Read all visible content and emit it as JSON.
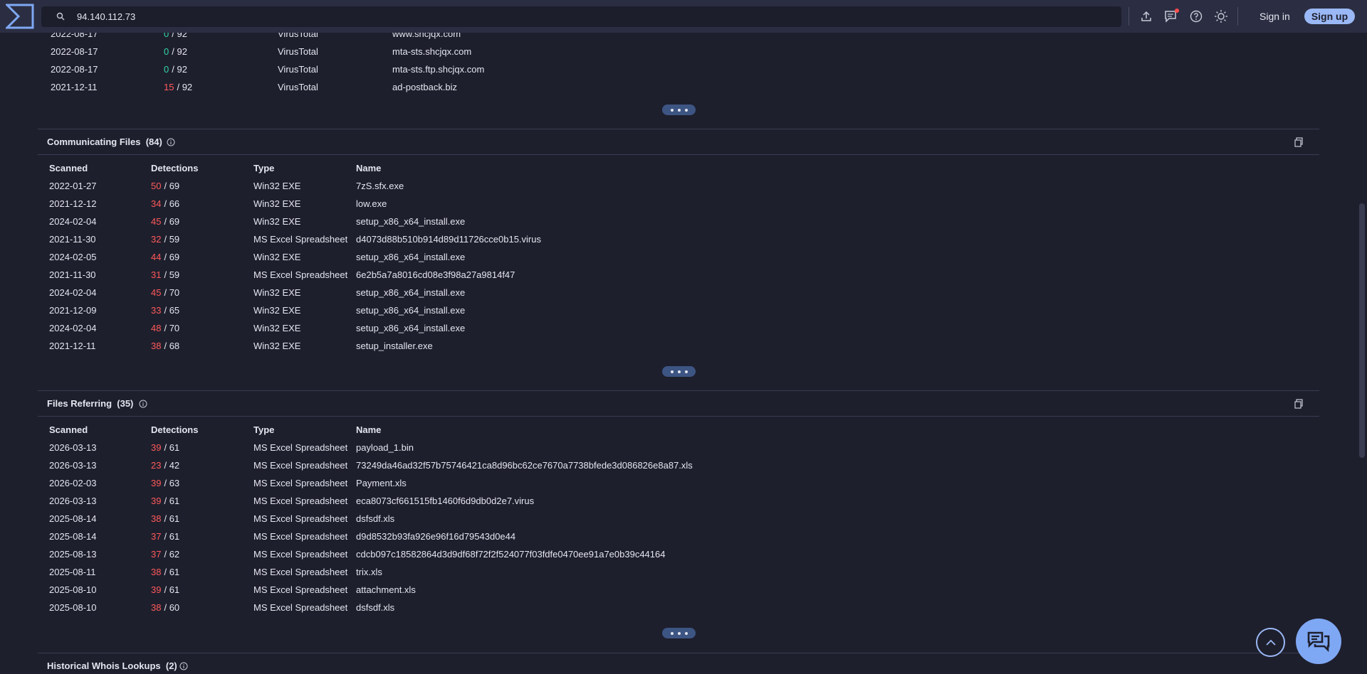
{
  "search": {
    "value": "94.140.112.73"
  },
  "header": {
    "signin_label": "Sign in",
    "signup_label": "Sign up"
  },
  "partial_rows": [
    {
      "date": "2022-08-17",
      "detected": "0",
      "total": "/ 92",
      "detected_color": "green",
      "source": "VirusTotal",
      "name": "www.shcjqx.com"
    },
    {
      "date": "2022-08-17",
      "detected": "0",
      "total": "/ 92",
      "detected_color": "green",
      "source": "VirusTotal",
      "name": "mta-sts.shcjqx.com"
    },
    {
      "date": "2022-08-17",
      "detected": "0",
      "total": "/ 92",
      "detected_color": "green",
      "source": "VirusTotal",
      "name": "mta-sts.ftp.shcjqx.com"
    },
    {
      "date": "2021-12-11",
      "detected": "15",
      "total": "/ 92",
      "detected_color": "red",
      "source": "VirusTotal",
      "name": "ad-postback.biz"
    }
  ],
  "communicating_files": {
    "title": "Communicating Files",
    "count": "(84)",
    "columns": [
      "Scanned",
      "Detections",
      "Type",
      "Name"
    ],
    "rows": [
      {
        "date": "2022-01-27",
        "detected": "50",
        "total": "/ 69",
        "type": "Win32 EXE",
        "name": "7zS.sfx.exe"
      },
      {
        "date": "2021-12-12",
        "detected": "34",
        "total": "/ 66",
        "type": "Win32 EXE",
        "name": "low.exe"
      },
      {
        "date": "2024-02-04",
        "detected": "45",
        "total": "/ 69",
        "type": "Win32 EXE",
        "name": "setup_x86_x64_install.exe"
      },
      {
        "date": "2021-11-30",
        "detected": "32",
        "total": "/ 59",
        "type": "MS Excel Spreadsheet",
        "name": "d4073d88b510b914d89d11726cce0b15.virus"
      },
      {
        "date": "2024-02-05",
        "detected": "44",
        "total": "/ 69",
        "type": "Win32 EXE",
        "name": "setup_x86_x64_install.exe"
      },
      {
        "date": "2021-11-30",
        "detected": "31",
        "total": "/ 59",
        "type": "MS Excel Spreadsheet",
        "name": "6e2b5a7a8016cd08e3f98a27a9814f47"
      },
      {
        "date": "2024-02-04",
        "detected": "45",
        "total": "/ 70",
        "type": "Win32 EXE",
        "name": "setup_x86_x64_install.exe"
      },
      {
        "date": "2021-12-09",
        "detected": "33",
        "total": "/ 65",
        "type": "Win32 EXE",
        "name": "setup_x86_x64_install.exe"
      },
      {
        "date": "2024-02-04",
        "detected": "48",
        "total": "/ 70",
        "type": "Win32 EXE",
        "name": "setup_x86_x64_install.exe"
      },
      {
        "date": "2021-12-11",
        "detected": "38",
        "total": "/ 68",
        "type": "Win32 EXE",
        "name": "setup_installer.exe"
      }
    ]
  },
  "files_referring": {
    "title": "Files Referring",
    "count": "(35)",
    "columns": [
      "Scanned",
      "Detections",
      "Type",
      "Name"
    ],
    "rows": [
      {
        "date": "2026-03-13",
        "detected": "39",
        "total": "/ 61",
        "type": "MS Excel Spreadsheet",
        "name": "payload_1.bin"
      },
      {
        "date": "2026-03-13",
        "detected": "23",
        "total": "/ 42",
        "type": "MS Excel Spreadsheet",
        "name": "73249da46ad32f57b75746421ca8d96bc62ce7670a7738bfede3d086826e8a87.xls"
      },
      {
        "date": "2026-02-03",
        "detected": "39",
        "total": "/ 63",
        "type": "MS Excel Spreadsheet",
        "name": "Payment.xls"
      },
      {
        "date": "2026-03-13",
        "detected": "39",
        "total": "/ 61",
        "type": "MS Excel Spreadsheet",
        "name": "eca8073cf661515fb1460f6d9db0d2e7.virus"
      },
      {
        "date": "2025-08-14",
        "detected": "38",
        "total": "/ 61",
        "type": "MS Excel Spreadsheet",
        "name": "dsfsdf.xls"
      },
      {
        "date": "2025-08-14",
        "detected": "37",
        "total": "/ 61",
        "type": "MS Excel Spreadsheet",
        "name": "d9d8532b93fa926e96f16d79543d0e44"
      },
      {
        "date": "2025-08-13",
        "detected": "37",
        "total": "/ 62",
        "type": "MS Excel Spreadsheet",
        "name": "cdcb097c18582864d3d9df68f72f2f524077f03fdfe0470ee91a7e0b39c44164"
      },
      {
        "date": "2025-08-11",
        "detected": "38",
        "total": "/ 61",
        "type": "MS Excel Spreadsheet",
        "name": "trix.xls"
      },
      {
        "date": "2025-08-10",
        "detected": "39",
        "total": "/ 61",
        "type": "MS Excel Spreadsheet",
        "name": "attachment.xls"
      },
      {
        "date": "2025-08-10",
        "detected": "38",
        "total": "/ 60",
        "type": "MS Excel Spreadsheet",
        "name": "dsfsdf.xls"
      }
    ]
  },
  "historical_whois": {
    "title": "Historical Whois Lookups",
    "count": "(2)"
  },
  "colors": {
    "accent": "#9ab8f5",
    "danger": "#ff5a5a",
    "clean": "#33d6a6",
    "background": "#1e1f2d",
    "topbar": "#2b2e42"
  }
}
